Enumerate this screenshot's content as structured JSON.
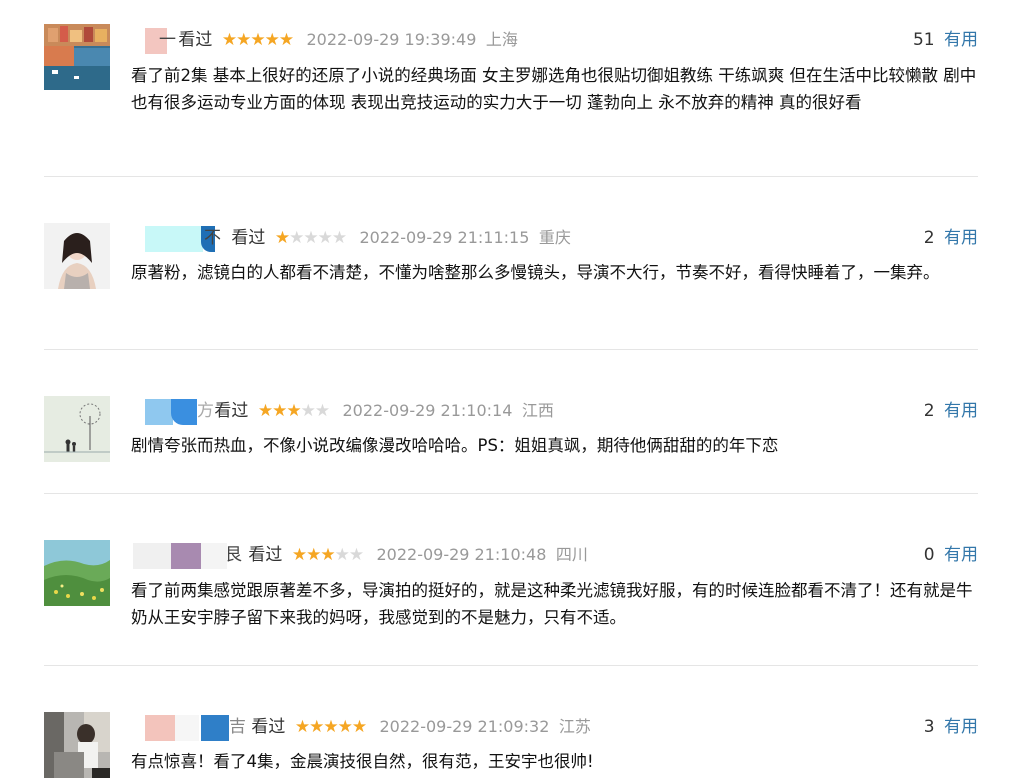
{
  "comments": [
    {
      "name_tail": "一",
      "watched": "看过",
      "stars": 5,
      "time": "2022-09-29 19:39:49",
      "location": "上海",
      "useful_count": "51",
      "useful_label": "有用",
      "text": "看了前2集 基本上很好的还原了小说的经典场面 女主罗娜选角也很贴切御姐教练 干练飒爽 但在生活中比较懒散 剧中也有很多运动专业方面的体现 表现出竞技运动的实力大于一切 蓬勃向上 永不放弃的精神 真的很好看"
    },
    {
      "name_tail": "不",
      "watched": "看过",
      "stars": 1,
      "time": "2022-09-29 21:11:15",
      "location": "重庆",
      "useful_count": "2",
      "useful_label": "有用",
      "text": "原著粉，滤镜白的人都看不清楚，不懂为啥整那么多慢镜头，导演不大行，节奏不好，看得快睡着了，一集弃。"
    },
    {
      "name_tail": "方",
      "watched": "看过",
      "stars": 3,
      "time": "2022-09-29 21:10:14",
      "location": "江西",
      "useful_count": "2",
      "useful_label": "有用",
      "text": "剧情夸张而热血，不像小说改编像漫改哈哈哈。PS：姐姐真飒，期待他俩甜甜的的年下恋"
    },
    {
      "name_tail": "艮",
      "watched": "看过",
      "stars": 3,
      "time": "2022-09-29 21:10:48",
      "location": "四川",
      "useful_count": "0",
      "useful_label": "有用",
      "text": "看了前两集感觉跟原著差不多，导演拍的挺好的，就是这种柔光滤镜我好服，有的时候连脸都看不清了！还有就是牛奶从王安宇脖子留下来我的妈呀，我感觉到的不是魅力，只有不适。"
    },
    {
      "name_tail": "吉",
      "watched": "看过",
      "stars": 5,
      "time": "2022-09-29 21:09:32",
      "location": "江苏",
      "useful_count": "3",
      "useful_label": "有用",
      "text": "有点惊喜！看了4集，金晨演技很自然，很有范，王安宇也很帅!"
    }
  ]
}
